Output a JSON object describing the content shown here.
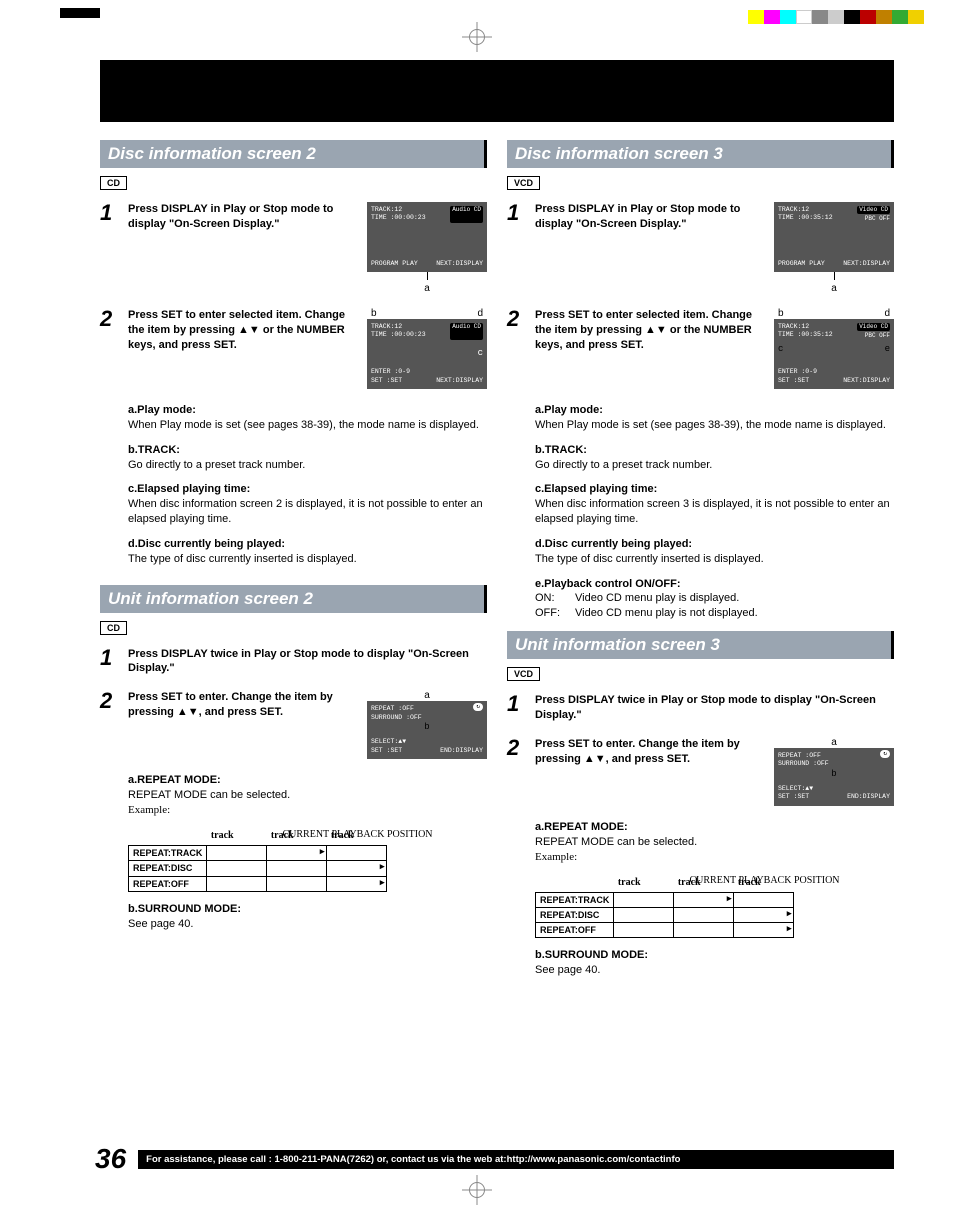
{
  "page_number": "36",
  "footer_text": "For assistance, please call : 1-800-211-PANA(7262) or, contact us via the web at:http://www.panasonic.com/contactinfo",
  "color_swatches": [
    "#fff",
    "#f0d000",
    "#ff00ff",
    "#00aaff",
    "#000",
    "#888",
    "#ccc",
    "#b00",
    "#c08000"
  ],
  "left": {
    "disc": {
      "title": "Disc information screen 2",
      "tag": "CD",
      "step1": "Press DISPLAY in Play or Stop mode to display \"On-Screen Display.\"",
      "step2": "Press SET to enter selected item. Change the item by pressing ▲▼ or the NUMBER keys, and press SET.",
      "osd1": {
        "track": "TRACK:12",
        "time": "TIME :00:00:23",
        "logo": "Audio CD",
        "mode": "PROGRAM PLAY",
        "next": "NEXT:DISPLAY",
        "marker_a": "a"
      },
      "osd2": {
        "track": "TRACK:12",
        "time": "TIME :00:00:23",
        "logo": "Audio CD",
        "enter": "ENTER :0-9",
        "set": "SET   :SET",
        "next": "NEXT:DISPLAY",
        "marker_b": "b",
        "marker_c": "c",
        "marker_d": "d"
      },
      "notes": {
        "a_t": "a.Play mode:",
        "a_b": "When Play mode is set (see pages 38-39), the mode name is displayed.",
        "b_t": "b.TRACK:",
        "b_b": "Go directly to a preset track number.",
        "c_t": "c.Elapsed playing time:",
        "c_b": "When disc information screen 2 is displayed, it is not possible to enter an elapsed playing time.",
        "d_t": "d.Disc currently being played:",
        "d_b": "The type of disc currently inserted is displayed."
      }
    },
    "unit": {
      "title": "Unit information screen 2",
      "tag": "CD",
      "step1": "Press DISPLAY twice in Play or Stop mode  to display \"On-Screen Display.\"",
      "step2": "Press SET to enter. Change the item by pressing ▲▼, and press SET.",
      "osd": {
        "repeat": "REPEAT    :OFF",
        "surround": "SURROUND  :OFF",
        "select": "SELECT:▲▼",
        "set": "SET  :SET",
        "end": "END:DISPLAY",
        "marker_a": "a",
        "marker_b": "b"
      },
      "notes": {
        "a_t": "a.REPEAT MODE:",
        "a_b": "REPEAT MODE can be selected.",
        "example": "Example:",
        "cpp": "CURRENT PLAYBACK POSITION",
        "rows": [
          "REPEAT:TRACK",
          "REPEAT:DISC",
          "REPEAT:OFF"
        ],
        "cols": [
          "track",
          "track",
          "track"
        ],
        "b_t": "b.SURROUND MODE:",
        "b_b": "See page 40."
      }
    }
  },
  "right": {
    "disc": {
      "title": "Disc information screen 3",
      "tag": "VCD",
      "step1": "Press DISPLAY in Play or Stop mode to display \"On-Screen Display.\"",
      "step2": "Press SET to enter selected item. Change the item by pressing ▲▼ or the NUMBER keys, and press SET.",
      "osd1": {
        "track": "TRACK:12",
        "time": "TIME :00:35:12",
        "logo": "Video CD",
        "pbc": "PBC OFF",
        "mode": "PROGRAM PLAY",
        "next": "NEXT:DISPLAY",
        "marker_a": "a"
      },
      "osd2": {
        "track": "TRACK:12",
        "time": "TIME :00:35:12",
        "logo": "Video CD",
        "pbc": "PBC OFF",
        "enter": "ENTER :0-9",
        "set": "SET   :SET",
        "next": "NEXT:DISPLAY",
        "marker_b": "b",
        "marker_c": "c",
        "marker_d": "d",
        "marker_e": "e"
      },
      "notes": {
        "a_t": "a.Play mode:",
        "a_b": "When Play mode is set (see pages 38-39), the mode name is displayed.",
        "b_t": "b.TRACK:",
        "b_b": "Go directly to a preset track number.",
        "c_t": "c.Elapsed playing time:",
        "c_b": "When disc information screen 3 is displayed, it is not possible to enter an elapsed playing time.",
        "d_t": "d.Disc currently being played:",
        "d_b": "The type of disc currently inserted is displayed.",
        "e_t": "e.Playback control ON/OFF:",
        "e_on_l": "ON:",
        "e_on_v": "Video CD menu play is displayed.",
        "e_off_l": "OFF:",
        "e_off_v": "Video CD menu play is not displayed."
      }
    },
    "unit": {
      "title": "Unit information screen 3",
      "tag": "VCD",
      "step1": "Press DISPLAY twice in Play or Stop mode  to display \"On-Screen Display.\"",
      "step2": "Press SET to enter. Change the item by pressing ▲▼, and press SET.",
      "osd": {
        "repeat": "REPEAT    :OFF",
        "surround": "SURROUND  :OFF",
        "select": "SELECT:▲▼",
        "set": "SET  :SET",
        "end": "END:DISPLAY",
        "marker_a": "a",
        "marker_b": "b"
      },
      "notes": {
        "a_t": "a.REPEAT MODE:",
        "a_b": "REPEAT MODE can be selected.",
        "example": "Example:",
        "cpp": "CURRENT PLAYBACK POSITION",
        "rows": [
          "REPEAT:TRACK",
          "REPEAT:DISC",
          "REPEAT:OFF"
        ],
        "cols": [
          "track",
          "track",
          "track"
        ],
        "b_t": "b.SURROUND MODE:",
        "b_b": "See page 40."
      }
    }
  }
}
